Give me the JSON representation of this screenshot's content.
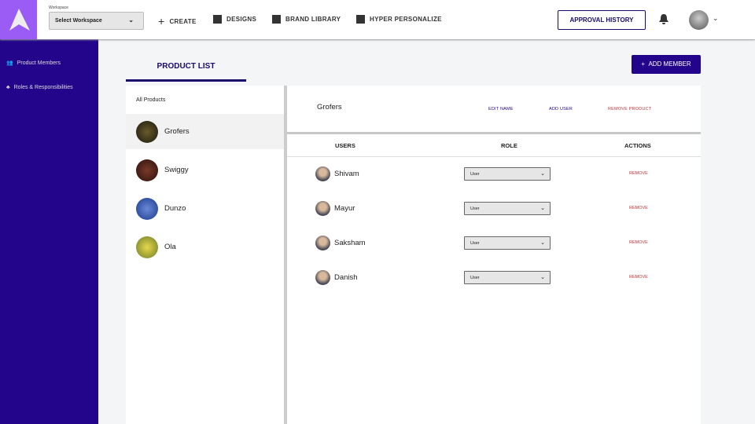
{
  "header": {
    "workspace_label": "Workspace",
    "workspace_value": "Select Workspace",
    "nav": [
      "CREATE",
      "DESIGNS",
      "BRAND LIBRARY",
      "HYPER PERSONALIZE"
    ],
    "approval": "APPROVAL HISTORY"
  },
  "sidebar": {
    "items": [
      {
        "label": "Product Members"
      },
      {
        "label": "Roles & Responsibilities"
      }
    ]
  },
  "tab": "PRODUCT LIST",
  "add_member": "ADD MEMBER",
  "products": {
    "all": "All Products",
    "items": [
      "Grofers",
      "Swiggy",
      "Dunzo",
      "Ola"
    ]
  },
  "detail": {
    "title": "Grofers",
    "edit": "EDIT NAME",
    "add_user": "ADD USER",
    "remove_product": "REMOVE PRODUCT",
    "cols": [
      "USERS",
      "ROLE",
      "ACTIONS"
    ],
    "rows": [
      {
        "name": "Shivam",
        "role": "User",
        "action": "REMOVE"
      },
      {
        "name": "Mayur",
        "role": "User",
        "action": "REMOVE"
      },
      {
        "name": "Saksham",
        "role": "User",
        "action": "REMOVE"
      },
      {
        "name": "Danish",
        "role": "User",
        "action": "REMOVE"
      }
    ]
  },
  "colors": {
    "primary": "#22058a",
    "logo": "#9b5cf5",
    "danger": "#c0323a"
  }
}
